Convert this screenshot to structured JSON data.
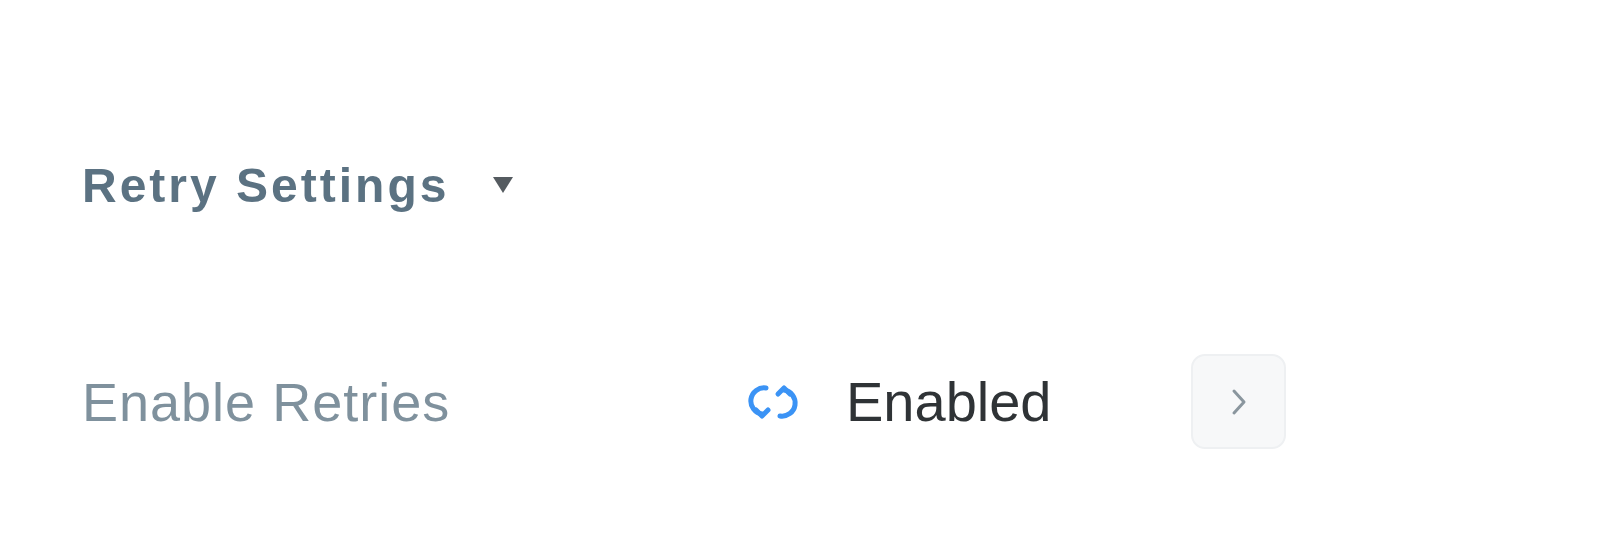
{
  "section": {
    "title": "Retry Settings",
    "expanded": true
  },
  "settings": [
    {
      "label": "Enable Retries",
      "value": "Enabled"
    }
  ]
}
